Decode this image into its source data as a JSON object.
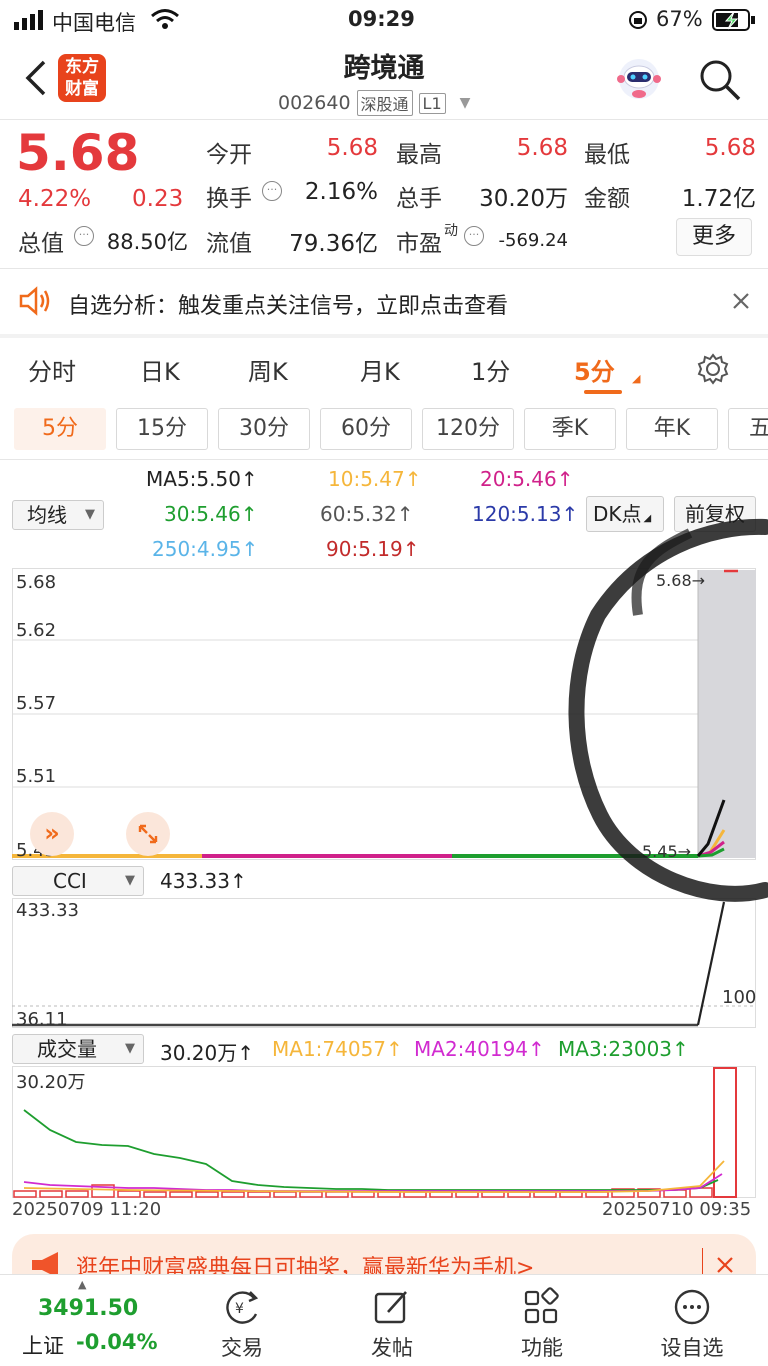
{
  "status_bar": {
    "carrier": "中国电信",
    "time": "09:29",
    "battery": "67%"
  },
  "header": {
    "app_logo_line1": "东方",
    "app_logo_line2": "财富",
    "title": "跨境通",
    "code": "002640",
    "market_tag": "深股通",
    "level_tag": "L1"
  },
  "quote": {
    "price": "5.68",
    "change_pct": "4.22%",
    "change": "0.23",
    "open_label": "今开",
    "open": "5.68",
    "high_label": "最高",
    "high": "5.68",
    "low_label": "最低",
    "low": "5.68",
    "turnover_label": "换手",
    "turnover": "2.16%",
    "volume_label": "总手",
    "volume": "30.20万",
    "amount_label": "金额",
    "amount": "1.72亿",
    "mktcap_label": "总值",
    "mktcap": "88.50亿",
    "float_label": "流值",
    "float": "79.36亿",
    "pe_label": "市盈",
    "pe_sup": "动",
    "pe": "-569.24",
    "more_button": "更多"
  },
  "banner": {
    "text": "自选分析：触发重点关注信号，立即点击查看"
  },
  "main_tabs": [
    "分时",
    "日K",
    "周K",
    "月K",
    "1分",
    "5分"
  ],
  "period_tabs": [
    "5分",
    "15分",
    "30分",
    "60分",
    "120分",
    "季K",
    "年K",
    "五"
  ],
  "ma_selector": "均线",
  "ma": {
    "ma5": "MA5:5.50↑",
    "ma10": "10:5.47↑",
    "ma20": "20:5.46↑",
    "ma30": "30:5.46↑",
    "ma60": "60:5.32↑",
    "ma120": "120:5.13↑",
    "ma250": "250:4.95↑",
    "ma90": "90:5.19↑"
  },
  "dk_button": "DK点",
  "adjust_button": "前复权",
  "price_chart": {
    "y_labels": [
      "5.68",
      "5.62",
      "5.57",
      "5.51",
      "5.45"
    ],
    "high_marker": "5.68→",
    "low_marker": "5.45→"
  },
  "cci": {
    "selector": "CCI",
    "value": "433.33↑",
    "max_label": "433.33",
    "min_label": "36.11",
    "ref_label": "100"
  },
  "volume": {
    "selector": "成交量",
    "value": "30.20万↑",
    "ma1": "MA1:74057↑",
    "ma2": "MA2:40194↑",
    "ma3": "MA3:23003↑",
    "max_label": "30.20万",
    "date_start": "20250709 11:20",
    "date_end": "20250710 09:35"
  },
  "ad": {
    "text": "逛年中财富盛典每日可抽奖，赢最新华为手机>"
  },
  "index": {
    "value": "3491.50",
    "name": "上证",
    "change": "-0.04%"
  },
  "bottom_nav": [
    "交易",
    "发帖",
    "功能",
    "设自选"
  ],
  "colors": {
    "up": "#e4393c",
    "down": "#1e9e2f",
    "accent": "#f06a1b",
    "ma10": "#f5b63b",
    "ma20": "#d0218a",
    "ma30": "#1e9e2f",
    "ma120": "#2b3aa8",
    "ma250": "#5ab4e8"
  }
}
